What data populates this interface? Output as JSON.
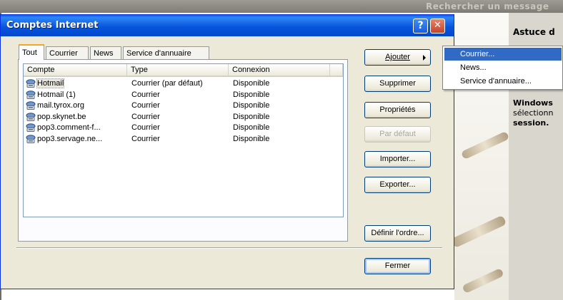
{
  "background": {
    "header_text": "Rechercher un message",
    "tip_title": "Astuce d",
    "tip_lines": [
      "Windows",
      "sélectionn",
      "session."
    ]
  },
  "dialog": {
    "title": "Comptes Internet",
    "help_glyph": "?",
    "close_glyph": "✕",
    "tabs": [
      {
        "label": "Tout",
        "active": true
      },
      {
        "label": "Courrier",
        "active": false
      },
      {
        "label": "News",
        "active": false
      },
      {
        "label": "Service d'annuaire",
        "active": false
      }
    ],
    "columns": [
      "Compte",
      "Type",
      "Connexion"
    ],
    "accounts": [
      {
        "name": "Hotmail",
        "type": "Courrier (par défaut)",
        "connection": "Disponible",
        "selected": true
      },
      {
        "name": "Hotmail (1)",
        "type": "Courrier",
        "connection": "Disponible",
        "selected": false
      },
      {
        "name": "mail.tyrox.org",
        "type": "Courrier",
        "connection": "Disponible",
        "selected": false
      },
      {
        "name": "pop.skynet.be",
        "type": "Courrier",
        "connection": "Disponible",
        "selected": false
      },
      {
        "name": "pop3.comment-f...",
        "type": "Courrier",
        "connection": "Disponible",
        "selected": false
      },
      {
        "name": "pop3.servage.ne...",
        "type": "Courrier",
        "connection": "Disponible",
        "selected": false
      }
    ],
    "buttons": {
      "add": "Ajouter",
      "remove": "Supprimer",
      "properties": "Propriétés",
      "set_default": "Par défaut",
      "import": "Importer...",
      "export": "Exporter...",
      "set_order": "Définir l'ordre...",
      "close": "Fermer"
    }
  },
  "add_menu": {
    "items": [
      {
        "label": "Courrier...",
        "highlighted": true
      },
      {
        "label": "News...",
        "highlighted": false
      },
      {
        "label": "Service d'annuaire...",
        "highlighted": false
      }
    ]
  },
  "colors": {
    "titlebar": "#0856dd",
    "menu_highlight": "#316ac5",
    "dialog_face": "#ece9d8"
  }
}
